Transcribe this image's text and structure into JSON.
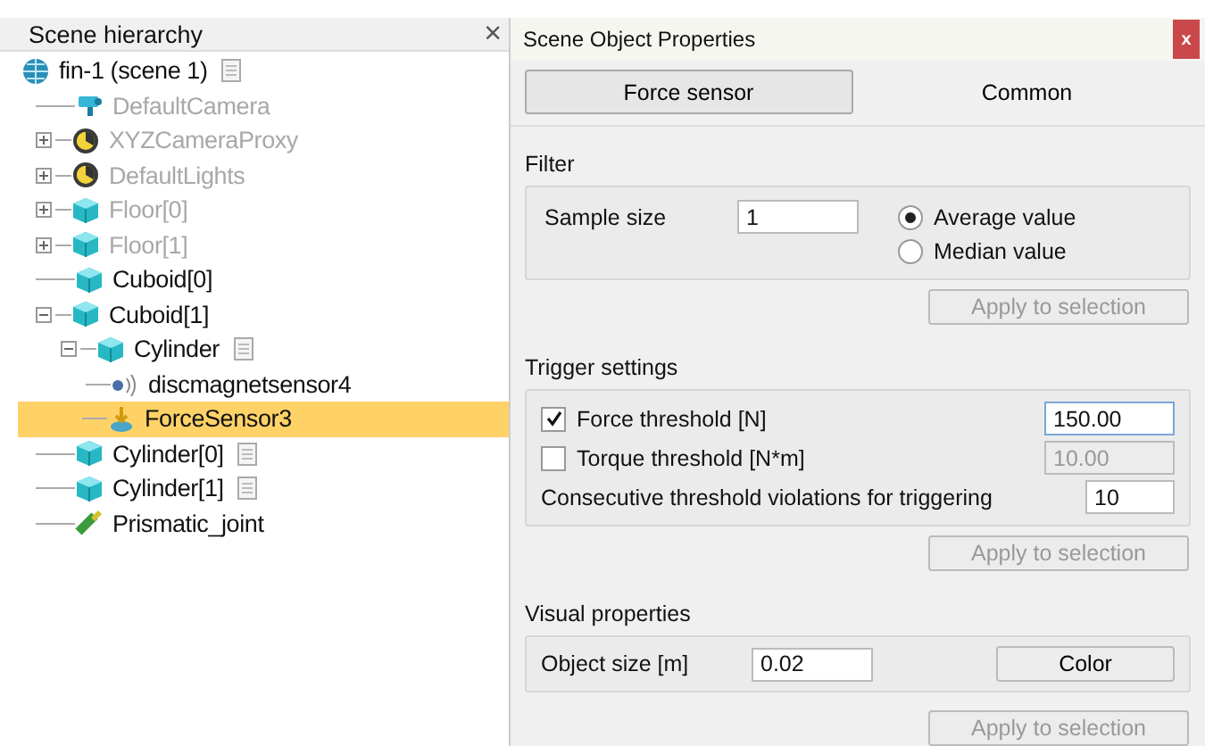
{
  "hierarchy": {
    "title": "Scene hierarchy",
    "close": "×",
    "items": [
      {
        "label": "fin-1 (scene 1)",
        "kind": "globe",
        "script": true,
        "disabled": false,
        "selected": false,
        "children": [
          {
            "label": "DefaultCamera",
            "kind": "camera",
            "script": false,
            "disabled": true,
            "selected": false
          },
          {
            "label": "XYZCameraProxy",
            "kind": "proxy",
            "script": false,
            "disabled": true,
            "selected": false,
            "expanded": false
          },
          {
            "label": "DefaultLights",
            "kind": "proxy",
            "script": false,
            "disabled": true,
            "selected": false,
            "expanded": false
          },
          {
            "label": "Floor[0]",
            "kind": "cube",
            "script": false,
            "disabled": true,
            "selected": false,
            "expanded": false
          },
          {
            "label": "Floor[1]",
            "kind": "cube",
            "script": false,
            "disabled": true,
            "selected": false,
            "expanded": false
          },
          {
            "label": "Cuboid[0]",
            "kind": "cube",
            "script": false,
            "disabled": false,
            "selected": false
          },
          {
            "label": "Cuboid[1]",
            "kind": "cube",
            "script": false,
            "disabled": false,
            "selected": false,
            "expanded": true,
            "children": [
              {
                "label": "Cylinder",
                "kind": "cube",
                "script": true,
                "disabled": false,
                "selected": false,
                "expanded": true,
                "children": [
                  {
                    "label": "discmagnetsensor4",
                    "kind": "proximity",
                    "script": false,
                    "disabled": false,
                    "selected": false
                  },
                  {
                    "label": "ForceSensor3",
                    "kind": "force",
                    "script": false,
                    "disabled": false,
                    "selected": true
                  }
                ]
              }
            ]
          },
          {
            "label": "Cylinder[0]",
            "kind": "cube",
            "script": true,
            "disabled": false,
            "selected": false
          },
          {
            "label": "Cylinder[1]",
            "kind": "cube",
            "script": true,
            "disabled": false,
            "selected": false
          },
          {
            "label": "Prismatic_joint",
            "kind": "joint",
            "script": false,
            "disabled": false,
            "selected": false
          }
        ]
      }
    ]
  },
  "properties": {
    "title": "Scene Object Properties",
    "close": "x",
    "tabs": [
      {
        "label": "Force sensor",
        "selected": true
      },
      {
        "label": "Common",
        "selected": false
      }
    ],
    "filter": {
      "title": "Filter",
      "sample_size_label": "Sample size",
      "sample_size": "1",
      "radios": [
        {
          "label": "Average value",
          "selected": true
        },
        {
          "label": "Median value",
          "selected": false
        }
      ],
      "apply": {
        "label": "Apply to selection",
        "disabled": true
      }
    },
    "trigger": {
      "title": "Trigger settings",
      "thresholds": [
        {
          "label": "Force threshold [N]",
          "checked": true,
          "value": "150.00"
        },
        {
          "label": "Torque threshold [N*m]",
          "checked": false,
          "value": "10.00"
        }
      ],
      "consecutive_label": "Consecutive threshold violations for triggering",
      "consecutive": "10",
      "apply": {
        "label": "Apply to selection",
        "disabled": true
      }
    },
    "visual": {
      "title": "Visual properties",
      "size_label": "Object size [m]",
      "size": "0.02",
      "color_button": "Color",
      "apply": {
        "label": "Apply to selection",
        "disabled": true
      }
    }
  }
}
